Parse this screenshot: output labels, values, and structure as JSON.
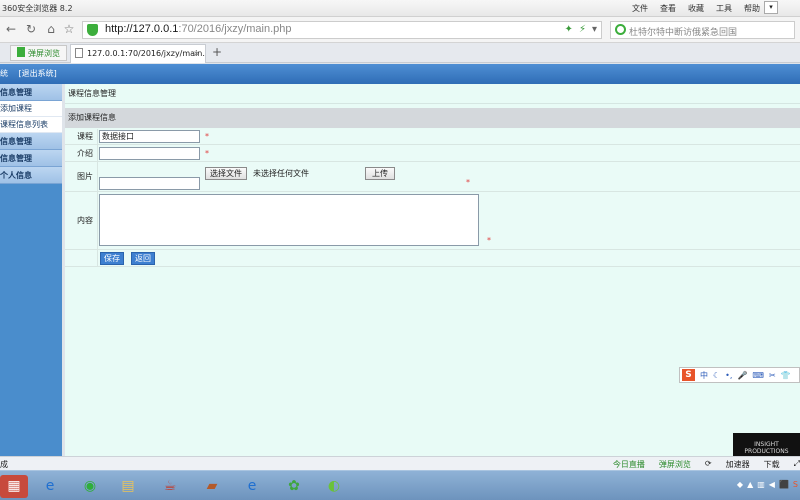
{
  "browser": {
    "title": "360安全浏览器 8.2",
    "menu": [
      "文件",
      "查看",
      "收藏",
      "工具",
      "帮助"
    ],
    "url_host": "http://127.0.0.1",
    "url_path": ":70/2016/jxzy/main.php",
    "search_text": "杜特尔特中断访俄紧急回国",
    "tab_ext_label": "弹屏浏览",
    "tab_label": "127.0.0.1:70/2016/jxzy/main.",
    "tab_close": "×",
    "tab_add": "+"
  },
  "app": {
    "header_links": [
      "统",
      "[退出系统]"
    ],
    "sidebar": [
      {
        "label": "信息管理",
        "type": "head"
      },
      {
        "label": "添加课程",
        "type": "sub"
      },
      {
        "label": "课程信息列表",
        "type": "sub"
      },
      {
        "label": "信息管理",
        "type": "head"
      },
      {
        "label": "信息管理",
        "type": "head"
      },
      {
        "label": "个人信息",
        "type": "head"
      }
    ],
    "breadcrumb": "课程信息管理",
    "section_title": "添加课程信息",
    "form": {
      "course_label": "课程",
      "course_value": "数据接口",
      "intro_label": "介绍",
      "intro_value": "",
      "image_label": "图片",
      "choose_file_label": "选择文件",
      "no_file_text": "未选择任何文件",
      "upload_label": "上传",
      "content_label": "内容",
      "required_mark": "*",
      "save_label": "保存",
      "back_label": "返回"
    }
  },
  "status": {
    "left": "成",
    "items": [
      "今日直播",
      "弹屏浏览",
      "加速器",
      "下载"
    ]
  },
  "ime": {
    "logo": "S",
    "mode": "中"
  },
  "logo_box_text": "INSIGHT PRODUCTIONS"
}
